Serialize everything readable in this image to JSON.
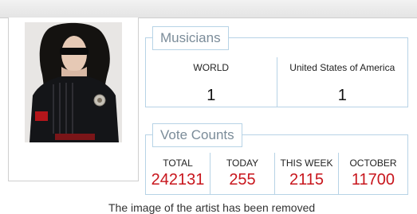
{
  "musicians": {
    "title": "Musicians",
    "columns": [
      {
        "label": "WORLD",
        "value": "1"
      },
      {
        "label": "United States of America",
        "value": "1"
      }
    ]
  },
  "votes": {
    "title": "Vote Counts",
    "columns": [
      {
        "label": "TOTAL",
        "value": "242131"
      },
      {
        "label": "TODAY",
        "value": "255"
      },
      {
        "label": "THIS WEEK",
        "value": "2115"
      },
      {
        "label": "OCTOBER",
        "value": "11700"
      }
    ]
  },
  "footer": {
    "text": "The image of the artist has been removed"
  },
  "colors": {
    "panel_border": "#b7d3e6",
    "vote_value": "#c8161d"
  }
}
